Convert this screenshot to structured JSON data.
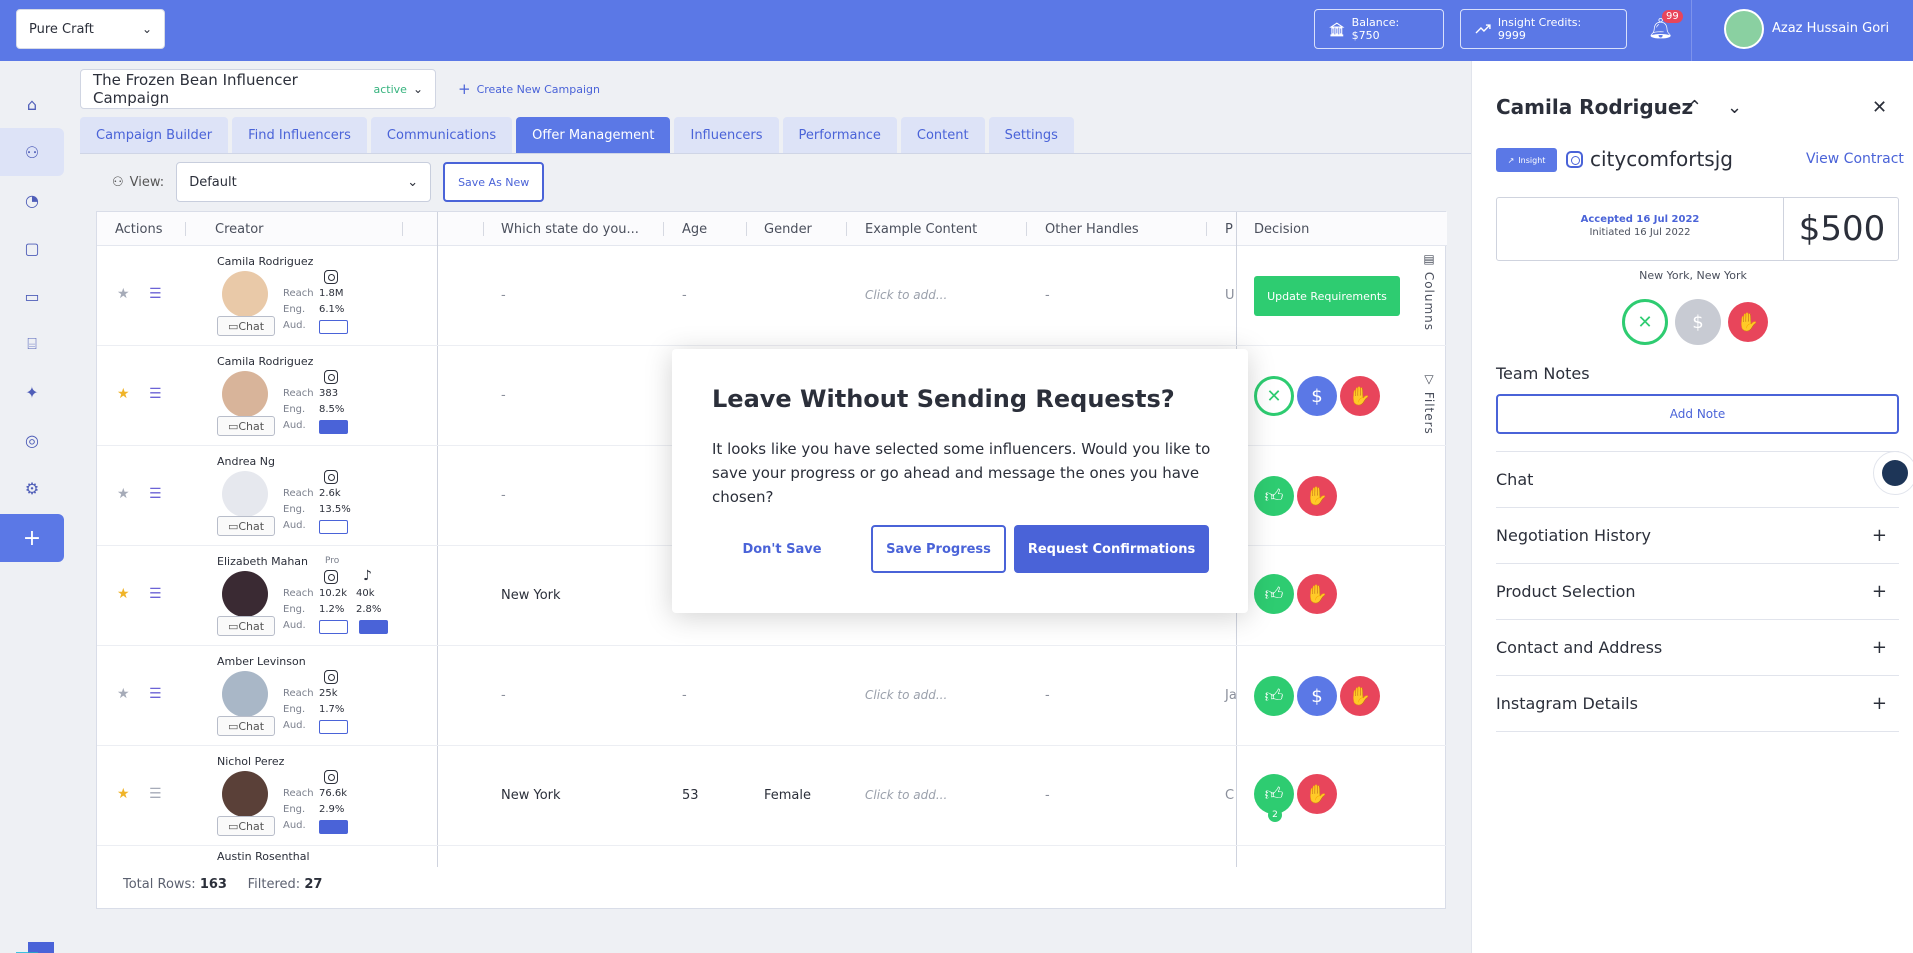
{
  "topbar": {
    "brand": "Pure Craft",
    "balance": "Balance: $750",
    "credits": "Insight Credits: 9999",
    "notif_count": "99",
    "user": "Azaz Hussain Gori"
  },
  "campaign": {
    "name": "The Frozen Bean Influencer Campaign",
    "status": "active",
    "create_label": "Create New Campaign"
  },
  "tabs": [
    {
      "label": "Campaign Builder"
    },
    {
      "label": "Find Influencers"
    },
    {
      "label": "Communications"
    },
    {
      "label": "Offer Management"
    },
    {
      "label": "Influencers"
    },
    {
      "label": "Performance"
    },
    {
      "label": "Content"
    },
    {
      "label": "Settings"
    }
  ],
  "view": {
    "label": "View:",
    "selected": "Default",
    "save_as_new": "Save As New"
  },
  "table": {
    "headers": {
      "actions": "Actions",
      "creator": "Creator",
      "state": "Which state do you...",
      "age": "Age",
      "gender": "Gender",
      "example": "Example Content",
      "other": "Other Handles",
      "p": "P",
      "decision": "Decision"
    },
    "stat_labels": {
      "reach": "Reach",
      "eng": "Eng.",
      "aud": "Aud."
    },
    "chat_label": "Chat",
    "click_add": "Click to add...",
    "dash": "-",
    "update_btn": "Update Requirements",
    "rows": [
      {
        "name": "Camila Rodriguez",
        "reach": "1.8M",
        "eng": "6.1%",
        "state": "-",
        "age": "-",
        "gender": "",
        "other": "-",
        "p": "U"
      },
      {
        "name": "Camila Rodriguez",
        "reach": "383",
        "eng": "8.5%",
        "state": "-",
        "age": "",
        "gender": "",
        "other": "",
        "p": ""
      },
      {
        "name": "Andrea Ng",
        "reach": "2.6k",
        "eng": "13.5%",
        "state": "-",
        "age": "",
        "gender": "",
        "other": "",
        "p": ""
      },
      {
        "name": "Elizabeth Mahan",
        "reach": "10.2k",
        "eng": "1.2%",
        "reach2": "40k",
        "eng2": "2.8%",
        "pro": "Pro",
        "state": "New York",
        "age": "",
        "gender": "",
        "other": "",
        "p": ""
      },
      {
        "name": "Amber Levinson",
        "reach": "25k",
        "eng": "1.7%",
        "state": "-",
        "age": "-",
        "gender": "",
        "other": "-",
        "p": "Ja"
      },
      {
        "name": "Nichol Perez",
        "reach": "76.6k",
        "eng": "2.9%",
        "state": "New York",
        "age": "53",
        "gender": "Female",
        "other": "-",
        "p": "C"
      },
      {
        "name": "Austin Rosenthal"
      }
    ],
    "side_columns": "Columns",
    "side_filters": "Filters",
    "badge_count": "2",
    "footer": {
      "total_label": "Total Rows:",
      "total": "163",
      "filtered_label": "Filtered:",
      "filtered": "27"
    }
  },
  "modal": {
    "title": "Leave Without Sending Requests?",
    "body": "It looks like you have selected some influencers. Would you like to save your progress or go ahead and message the ones you have chosen?",
    "dont_save": "Don't Save",
    "save_progress": "Save Progress",
    "request": "Request Confirmations"
  },
  "panel": {
    "name": "Camila Rodriguez",
    "insight": "Insight",
    "handle": "citycomfortsjg",
    "view_contract": "View Contract",
    "accepted": "Accepted 16 Jul 2022",
    "initiated": "Initiated 16 Jul 2022",
    "price": "$500",
    "location": "New York, New York",
    "team_notes": "Team Notes",
    "add_note": "Add Note",
    "sections": [
      "Chat",
      "Negotiation History",
      "Product Selection",
      "Contact and Address",
      "Instagram Details"
    ]
  }
}
